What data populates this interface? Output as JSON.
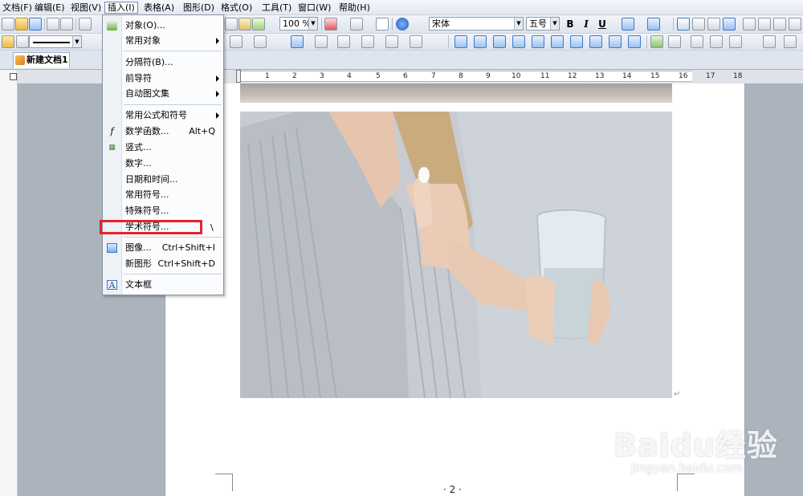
{
  "menubar": {
    "items": [
      {
        "label": "文档(F)"
      },
      {
        "label": "编辑(E)"
      },
      {
        "label": "视图(V)"
      },
      {
        "label": "插入(I)"
      },
      {
        "label": "表格(A)"
      },
      {
        "label": "图形(D)"
      },
      {
        "label": "格式(O)"
      },
      {
        "label": "工具(T)"
      },
      {
        "label": "窗口(W)"
      },
      {
        "label": "帮助(H)"
      }
    ]
  },
  "toolbar": {
    "zoom": "100 %",
    "font_name": "宋体",
    "font_size": "五号",
    "bold": "B",
    "italic": "I",
    "underline": "U"
  },
  "tab": {
    "label": "新建文档1"
  },
  "ruler": {
    "ticks": [
      "1",
      "2",
      "3",
      "4",
      "5",
      "6",
      "7",
      "8",
      "9",
      "10",
      "11",
      "12",
      "13",
      "14",
      "15",
      "16",
      "17",
      "18"
    ]
  },
  "insert_menu": {
    "items": [
      {
        "label": "对象(O)...",
        "icon": "object-icon"
      },
      {
        "label": "常用对象",
        "submenu": true
      },
      {
        "label": "分隔符(B)..."
      },
      {
        "label": "前导符",
        "submenu": true
      },
      {
        "label": "自动图文集",
        "submenu": true
      },
      {
        "label": "常用公式和符号",
        "submenu": true
      },
      {
        "label": "数学函数...",
        "shortcut": "Alt+Q",
        "icon": "function-icon"
      },
      {
        "label": "竖式...",
        "icon": "vertical-calc-icon"
      },
      {
        "label": "数字..."
      },
      {
        "label": "日期和时间..."
      },
      {
        "label": "常用符号..."
      },
      {
        "label": "特殊符号..."
      },
      {
        "label": "学术符号..."
      },
      {
        "label": "图像...",
        "shortcut": "Ctrl+Shift+I",
        "icon": "image-icon"
      },
      {
        "label": "新图形",
        "shortcut": "Ctrl+Shift+D"
      },
      {
        "label": "文本框",
        "icon": "textbox-icon"
      }
    ],
    "extra_glyph": "\\"
  },
  "document": {
    "page_number": "· 2 ·",
    "para_mark": "↵"
  },
  "watermark": {
    "brand": "Baidu经验",
    "url": "jingyan.baidu.com"
  },
  "colors": {
    "highlight": "#e3242b",
    "accent": "#3a78c9"
  }
}
